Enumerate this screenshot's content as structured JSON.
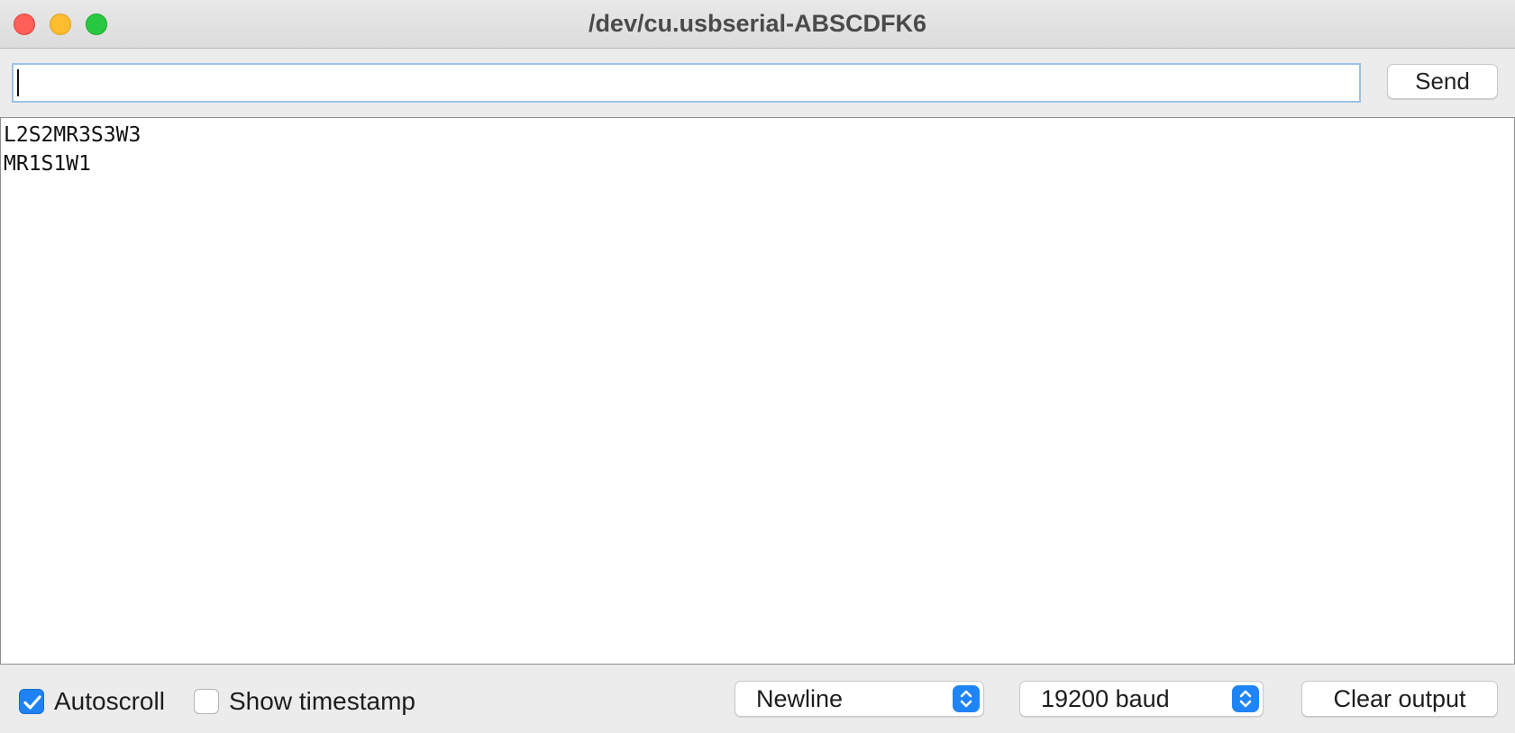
{
  "window": {
    "title": "/dev/cu.usbserial-ABSCDFK6",
    "controls": [
      "close-icon",
      "minimize-icon",
      "maximize-icon"
    ]
  },
  "send_bar": {
    "input_value": "",
    "send_label": "Send"
  },
  "output": {
    "lines": [
      "L2S2MR3S3W3",
      "MR1S1W1"
    ]
  },
  "footer": {
    "autoscroll": {
      "label": "Autoscroll",
      "checked": true
    },
    "show_timestamp": {
      "label": "Show timestamp",
      "checked": false
    },
    "line_ending": {
      "selected": "Newline"
    },
    "baud_rate": {
      "selected": "19200 baud"
    },
    "clear_label": "Clear output"
  },
  "colors": {
    "accent": "#1f84f5",
    "close": "#fe5f57",
    "minimize": "#febc2e",
    "maximize": "#28c840"
  }
}
